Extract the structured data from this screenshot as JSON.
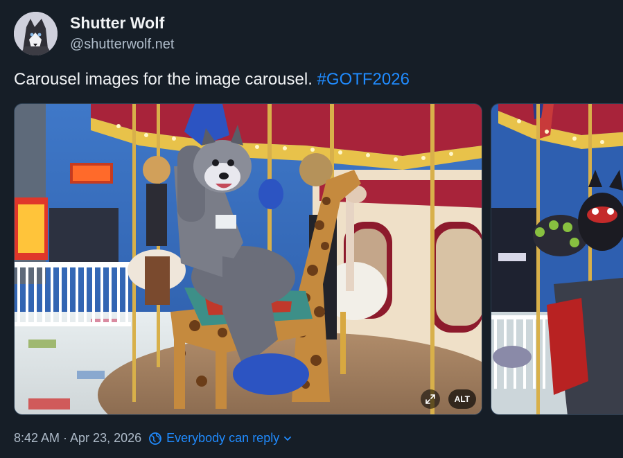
{
  "author": {
    "display_name": "Shutter Wolf",
    "handle": "@shutterwolf.net",
    "avatar_icon": "wolf-avatar"
  },
  "post": {
    "text": "Carousel images for the image carousel. ",
    "hashtag": "#GOTF2026"
  },
  "media": {
    "alt_badge": "ALT",
    "expand_icon": "expand-icon",
    "image_count": 2
  },
  "meta": {
    "timestamp": "8:42 AM · Apr 23, 2026",
    "reply_setting": "Everybody can reply",
    "reply_icon": "globe-icon",
    "chevron_icon": "chevron-down-icon"
  },
  "colors": {
    "background": "#161e27",
    "accent": "#208bfe",
    "secondary_text": "#aebbc9"
  }
}
